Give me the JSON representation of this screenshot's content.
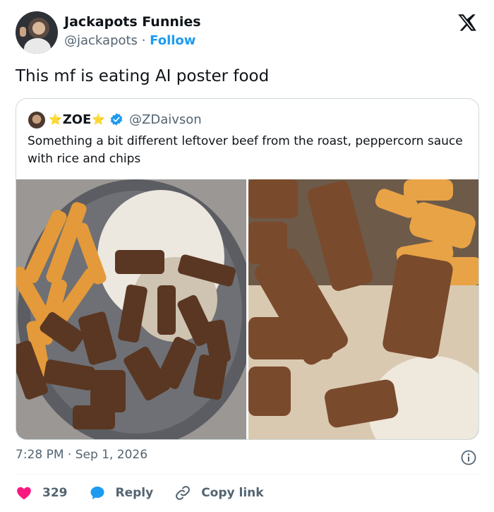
{
  "author": {
    "display_name": "Jackapots Funnies",
    "handle": "@jackapots",
    "separator": "·",
    "follow_label": "Follow"
  },
  "tweet": {
    "text": "This mf is eating AI poster food",
    "timestamp": "7:28 PM · Sep 1, 2026"
  },
  "quoted": {
    "name": "ZOE",
    "name_decoration": "⭐",
    "handle": "@ZDaivson",
    "text": "Something a bit different leftover beef from the roast, peppercorn sauce with rice and chips"
  },
  "actions": {
    "likes_count": "329",
    "reply_label": "Reply",
    "copy_link_label": "Copy link"
  },
  "colors": {
    "accent": "#1d9bf0",
    "like": "#f91880",
    "muted": "#536471"
  },
  "icons": {
    "logo": "x-logo-icon",
    "verified": "verified-badge-icon",
    "info": "info-icon",
    "like": "heart-icon",
    "reply": "reply-bubble-icon",
    "copy_link": "link-icon"
  }
}
